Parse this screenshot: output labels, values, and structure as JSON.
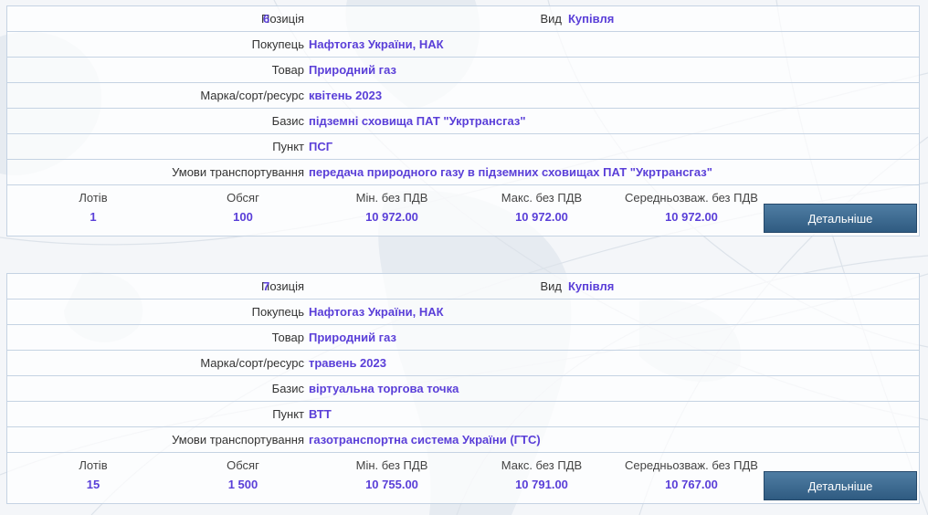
{
  "labels": {
    "position": "Позиція",
    "kind": "Вид",
    "buyer": "Покупець",
    "product": "Товар",
    "grade": "Марка/сорт/ресурс",
    "basis": "Базис",
    "point": "Пункт",
    "transport": "Умови транспортування",
    "lots": "Лотів",
    "volume": "Обсяг",
    "min": "Мін. без ПДВ",
    "max": "Макс. без ПДВ",
    "avg": "Середньозваж. без ПДВ",
    "details": "Детальніше"
  },
  "items": [
    {
      "position": "6",
      "kind": "Купівля",
      "buyer": "Нафтогаз України, НАК",
      "product": "Природний газ",
      "grade": "квітень 2023",
      "basis": "підземні сховища ПАТ \"Укртрансгаз\"",
      "point": "ПСГ",
      "transport": "передача природного газу в підземних сховищах ПАТ \"Укртрансгаз\"",
      "lots": "1",
      "volume": "100",
      "min": "10 972.00",
      "max": "10 972.00",
      "avg": "10 972.00"
    },
    {
      "position": "7",
      "kind": "Купівля",
      "buyer": "Нафтогаз України, НАК",
      "product": "Природний газ",
      "grade": "травень 2023",
      "basis": "віртуальна торгова точка",
      "point": "ВТТ",
      "transport": "газотранспортна система України (ГТС)",
      "lots": "15",
      "volume": "1 500",
      "min": "10 755.00",
      "max": "10 791.00",
      "avg": "10 767.00"
    }
  ]
}
